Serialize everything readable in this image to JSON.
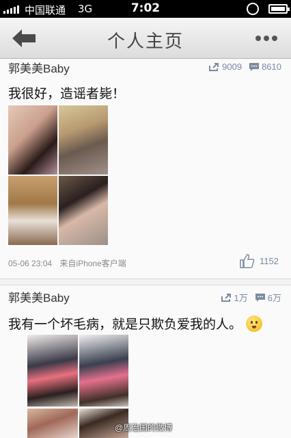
{
  "status_bar": {
    "carrier": "中国联通",
    "network": "3G",
    "time": "7:02"
  },
  "nav": {
    "title": "个人主页",
    "back_icon": "back-arrow-icon",
    "more_icon": "more-dots-icon"
  },
  "posts": [
    {
      "author": "郭美美Baby",
      "reposts": "9009",
      "comments": "8610",
      "text": "我很好，造谣者毙！",
      "time": "05-06 23:04",
      "source": "来自iPhone客户端",
      "likes": "1152"
    },
    {
      "author": "郭美美Baby",
      "reposts": "1万",
      "comments": "6万",
      "text": "我有一个坏毛病，就是只欺负爱我的人。"
    }
  ],
  "watermark": "@周治国的微博",
  "colors": {
    "stat_text": "#7a8aa0",
    "nav_title": "#444444"
  }
}
